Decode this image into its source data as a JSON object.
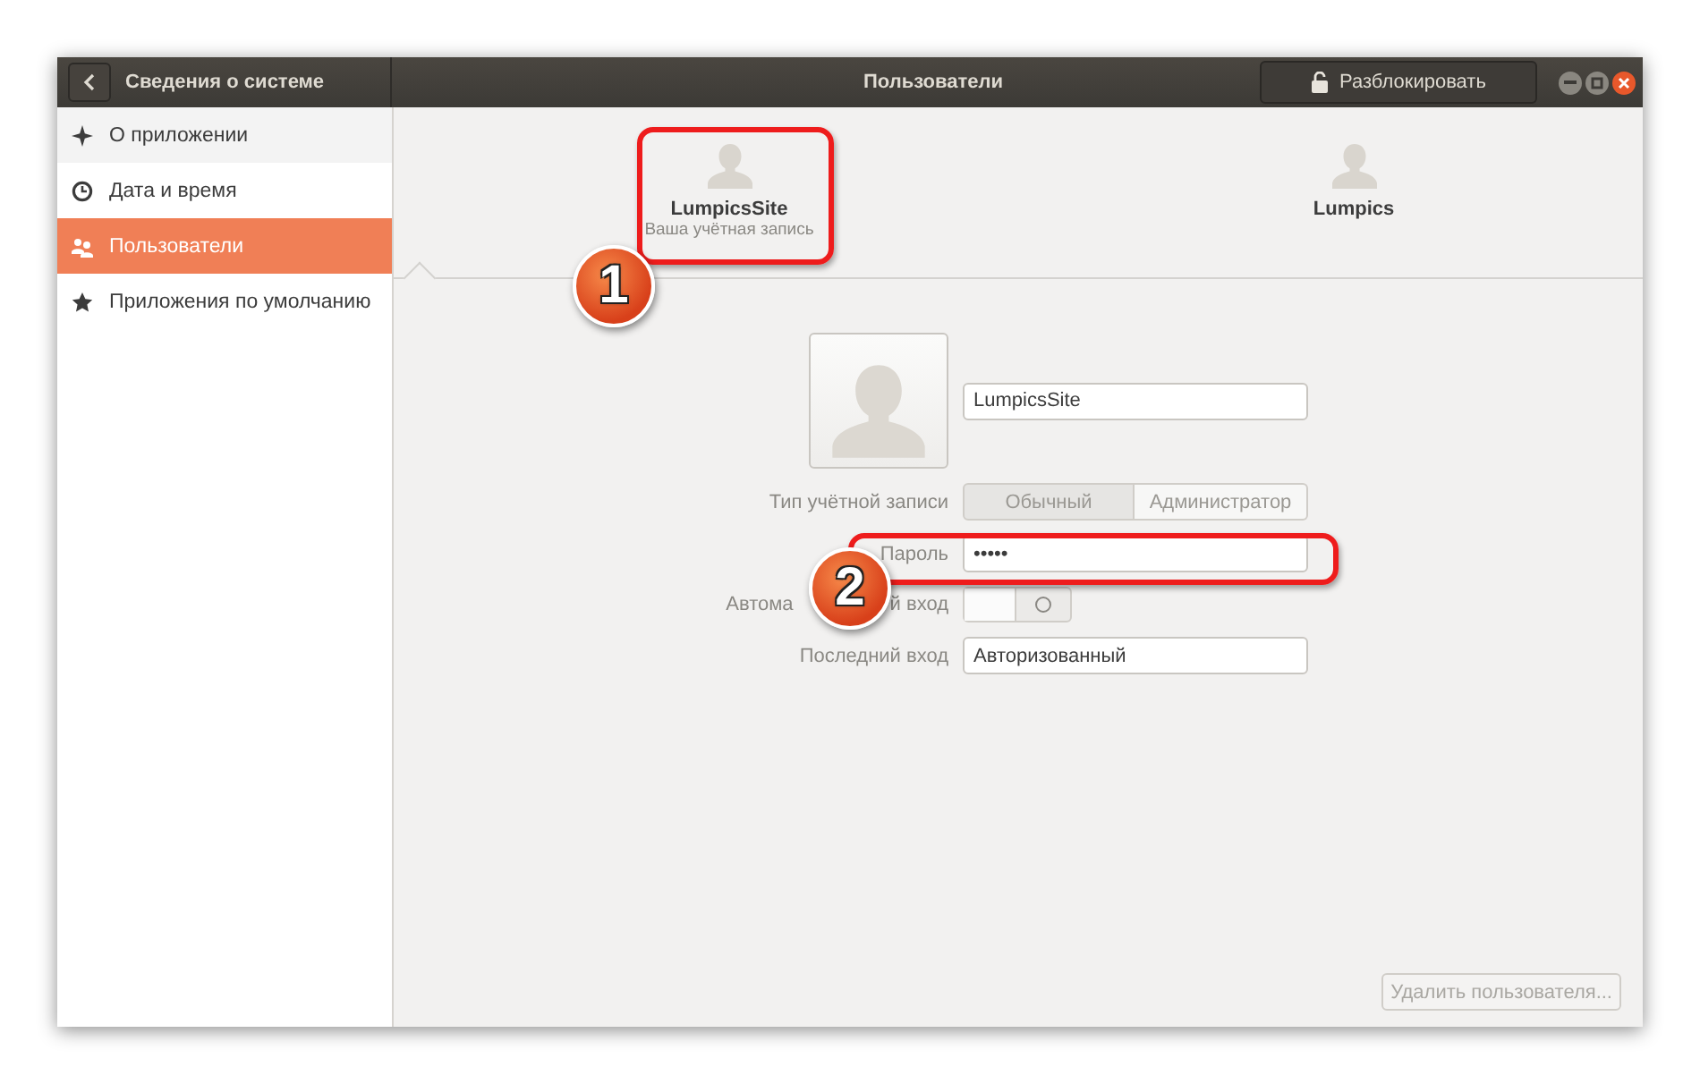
{
  "window": {
    "title": "Сведения о системе",
    "page_title": "Пользователи",
    "unlock_button": "Разблокировать"
  },
  "sidebar": {
    "items": [
      {
        "label": "О приложении",
        "selected": false
      },
      {
        "label": "Дата и время",
        "selected": false
      },
      {
        "label": "Пользователи",
        "selected": true
      },
      {
        "label": "Приложения по умолчанию",
        "selected": false
      }
    ]
  },
  "users": [
    {
      "name": "LumpicsSite",
      "subtitle": "Ваша учётная запись",
      "selected": true
    },
    {
      "name": "Lumpics",
      "selected": false
    }
  ],
  "account": {
    "name_value": "LumpicsSite",
    "account_type": {
      "label": "Тип учётной записи",
      "options": [
        {
          "label": "Обычный",
          "selected": true
        },
        {
          "label": "Администратор",
          "selected": false
        }
      ]
    },
    "password": {
      "label": "Пароль",
      "value": "•••••"
    },
    "auto_login": {
      "label_parts": [
        "Автома",
        "й вход"
      ],
      "on": false
    },
    "last_login": {
      "label": "Последний вход",
      "value": "Авторизованный"
    }
  },
  "delete_button": {
    "label": "Удалить пользователя...",
    "disabled": true
  },
  "annotations": [
    {
      "number": "1"
    },
    {
      "number": "2"
    }
  ]
}
